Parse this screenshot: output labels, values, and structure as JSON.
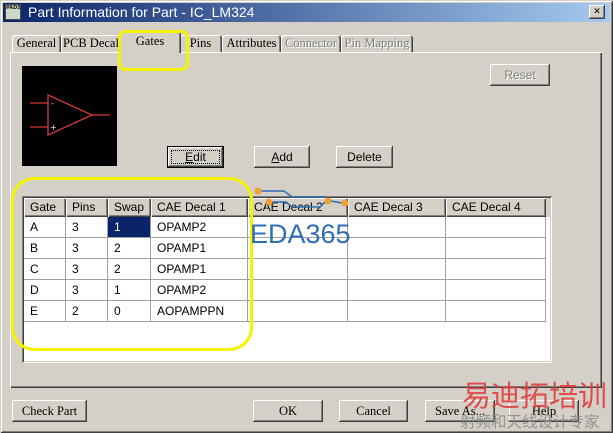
{
  "window": {
    "title": "Part Information for Part - IC_LM324",
    "app_icon": "pads-app-icon",
    "app_icon_text": "PADS",
    "close_icon": "close-icon",
    "close_glyph": "✕"
  },
  "tabs": [
    {
      "label": "General",
      "selected": false,
      "disabled": false
    },
    {
      "label": "PCB Decal",
      "selected": false,
      "disabled": false
    },
    {
      "label": "Gates",
      "selected": true,
      "disabled": false
    },
    {
      "label": "Pins",
      "selected": false,
      "disabled": false
    },
    {
      "label": "Attributes",
      "selected": false,
      "disabled": false
    },
    {
      "label": "Connector",
      "selected": false,
      "disabled": true
    },
    {
      "label": "Pin Mapping",
      "selected": false,
      "disabled": true
    }
  ],
  "gates_panel": {
    "preview": {
      "icon": "opamp-symbol-icon",
      "minus_sign": "-",
      "plus_sign": "+"
    },
    "reset": {
      "label": "Reset",
      "enabled": false
    },
    "edit": {
      "label": "Edit",
      "focused": true
    },
    "add": {
      "label": "Add"
    },
    "delete": {
      "label": "Delete"
    },
    "table": {
      "columns": [
        "Gate",
        "Pins",
        "Swap",
        "CAE Decal 1",
        "CAE Decal 2",
        "CAE Decal 3",
        "CAE Decal 4"
      ],
      "rows": [
        {
          "gate": "A",
          "pins": "3",
          "swap": "1",
          "cae_decal_1": "OPAMP2"
        },
        {
          "gate": "B",
          "pins": "3",
          "swap": "2",
          "cae_decal_1": "OPAMP1"
        },
        {
          "gate": "C",
          "pins": "3",
          "swap": "2",
          "cae_decal_1": "OPAMP1"
        },
        {
          "gate": "D",
          "pins": "3",
          "swap": "1",
          "cae_decal_1": "OPAMP2"
        },
        {
          "gate": "E",
          "pins": "2",
          "swap": "0",
          "cae_decal_1": "AOPAMPPN"
        }
      ],
      "selected_cell": {
        "row": 0,
        "column": 2
      }
    }
  },
  "footer": {
    "check_part": "Check Part",
    "ok": "OK",
    "cancel": "Cancel",
    "save_as": "Save As...",
    "help": "Help"
  },
  "watermarks": {
    "eda365": "EDA365",
    "brand_cn": "易迪拓培训",
    "tagline_cn": "射频和天线设计专家"
  },
  "colors": {
    "title_start": "#0a246a",
    "title_end": "#a6caf0",
    "face": "#d4d0c8",
    "selection": "#0a246a",
    "annotation": "#f4f400",
    "symbol_red": "#d83a3a",
    "watermark_blue": "#2f6db5",
    "watermark_orange": "#f0a030",
    "watermark_red": "#e03a3a",
    "watermark_gray": "#8c8c8c"
  }
}
